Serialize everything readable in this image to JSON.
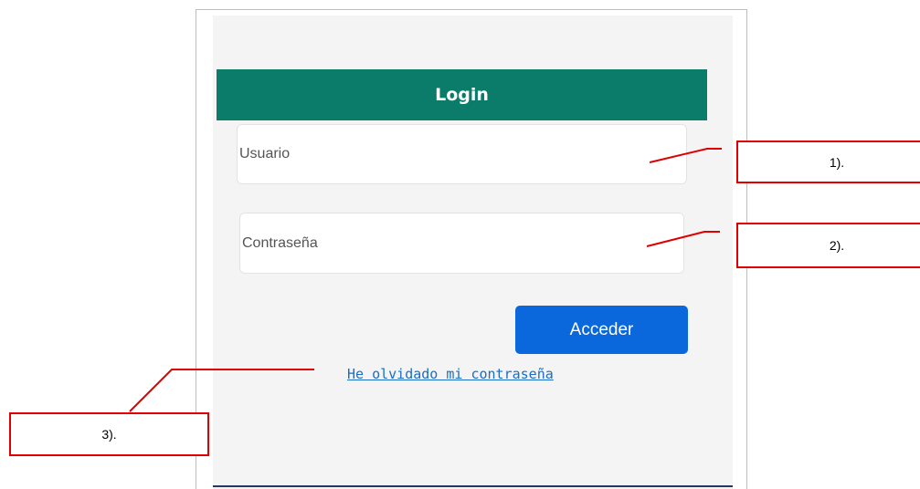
{
  "login": {
    "header": "Login",
    "username_placeholder": "Usuario",
    "password_placeholder": "Contraseña",
    "submit_label": "Acceder",
    "forgot_link": "He olvidado mi contraseña"
  },
  "annotations": {
    "callout_1": "1).",
    "callout_2": "2).",
    "callout_3": "3)."
  },
  "colors": {
    "header_bg": "#0b7b6a",
    "button_bg": "#0b67dc",
    "link": "#1a6dc9",
    "annotation": "#e00000"
  }
}
